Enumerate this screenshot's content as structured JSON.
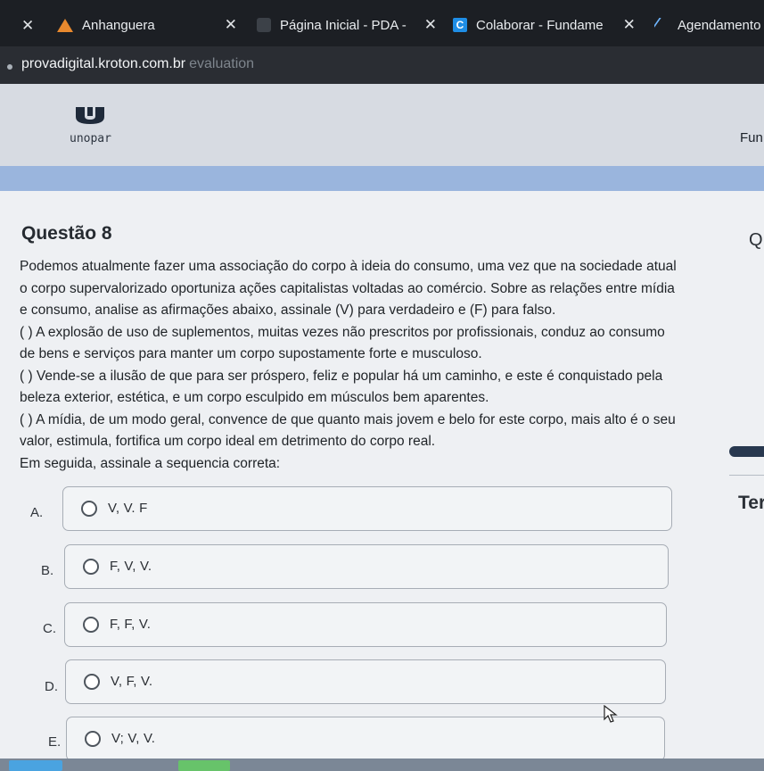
{
  "tabs": [
    {
      "label": "Anhanguera",
      "icon": "anhanguera-triangle-icon"
    },
    {
      "label": "Página Inicial - PDA -",
      "icon": "blank-page-icon"
    },
    {
      "label": "Colaborar - Fundame",
      "icon": "colaborar-c-icon"
    },
    {
      "label": "Agendamento c",
      "icon": "agendamento-icon"
    }
  ],
  "url": {
    "host": "provadigital.kroton.com.br",
    "path": "evaluation"
  },
  "site": {
    "logo_text": "unopar",
    "header_right": "Fun"
  },
  "question": {
    "title": "Questão 8",
    "lines": [
      "Podemos atualmente fazer uma associação do corpo à ideia do consumo, uma vez que na sociedade atual",
      "o corpo supervalorizado oportuniza ações capitalistas voltadas ao comércio. Sobre as relações entre mídia",
      "e consumo, analise as afirmações abaixo, assinale (V) para verdadeiro e (F) para falso.",
      "( ) A explosão de uso de suplementos, muitas vezes não prescritos por profissionais, conduz ao consumo",
      "de bens e serviços para manter um corpo supostamente forte e musculoso.",
      "( ) Vende-se a ilusão de que para ser próspero, feliz e popular há um caminho, e este é conquistado pela",
      "beleza exterior, estética, e um corpo esculpido em músculos bem aparentes.",
      "( ) A mídia, de um modo geral, convence de que quanto mais jovem e belo for este corpo, mais alto é o seu",
      "valor, estimula, fortifica um corpo ideal em detrimento do corpo real.",
      "Em seguida, assinale a sequencia correta:"
    ]
  },
  "options": [
    {
      "letter": "A.",
      "text": "V, V. F"
    },
    {
      "letter": "B.",
      "text": "F, V, V."
    },
    {
      "letter": "C.",
      "text": "F, F, V."
    },
    {
      "letter": "D.",
      "text": "V, F, V."
    },
    {
      "letter": "E.",
      "text": "V; V, V."
    }
  ],
  "side_panel": {
    "q_label": "Q",
    "ter_label": "Ter"
  },
  "colors": {
    "tabbar": "#1c1f24",
    "hero": "#9ab5dd",
    "accent": "#28384f"
  }
}
